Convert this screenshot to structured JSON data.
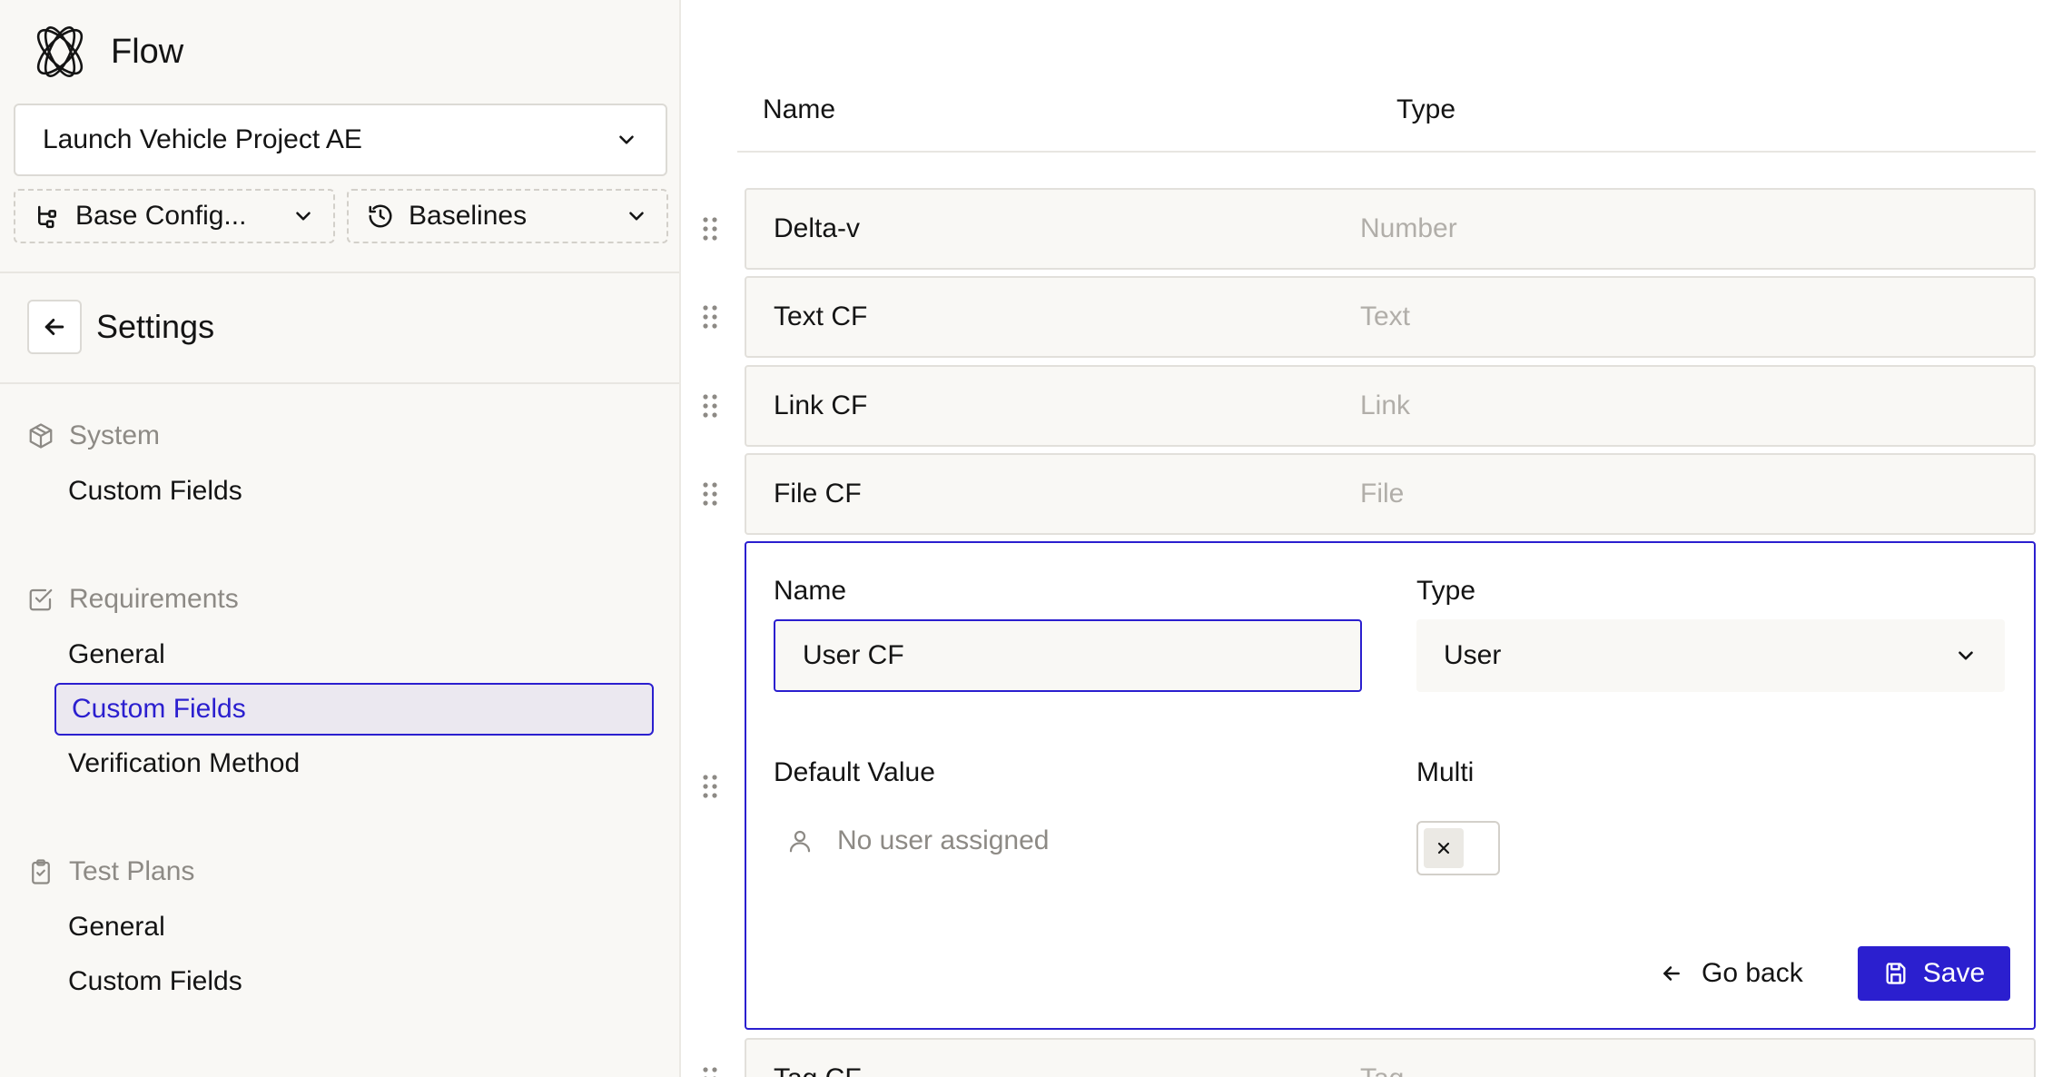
{
  "app": {
    "name": "Flow"
  },
  "project": {
    "selected": "Launch Vehicle Project AE"
  },
  "config": {
    "base_label": "Base Config...",
    "baselines_label": "Baselines"
  },
  "settings": {
    "title": "Settings"
  },
  "sections": [
    {
      "title": "System",
      "icon": "cube-icon",
      "items": [
        "Custom Fields"
      ]
    },
    {
      "title": "Requirements",
      "icon": "checkbox-icon",
      "items": [
        "General",
        "Custom Fields",
        "Verification Method"
      ]
    },
    {
      "title": "Test Plans",
      "icon": "clipboard-check-icon",
      "items": [
        "General",
        "Custom Fields"
      ]
    }
  ],
  "active_item": "Requirements / Custom Fields",
  "table": {
    "headers": {
      "name": "Name",
      "type": "Type"
    },
    "rows": [
      {
        "name": "Delta-v",
        "type": "Number"
      },
      {
        "name": "Text CF",
        "type": "Text"
      },
      {
        "name": "Link CF",
        "type": "Link"
      },
      {
        "name": "File CF",
        "type": "File"
      },
      {
        "name": "Tag CF",
        "type": "Tag"
      }
    ]
  },
  "editor": {
    "name_label": "Name",
    "name_value": "User CF",
    "type_label": "Type",
    "type_value": "User",
    "default_label": "Default Value",
    "default_placeholder": "No user assigned",
    "multi_label": "Multi",
    "multi_enabled": false,
    "go_back_label": "Go back",
    "save_label": "Save"
  },
  "colors": {
    "accent": "#2b1fcf",
    "sidebar_bg": "#f9f8f5",
    "muted_text": "#8d8a85",
    "row_type_text": "#b1aea9"
  }
}
